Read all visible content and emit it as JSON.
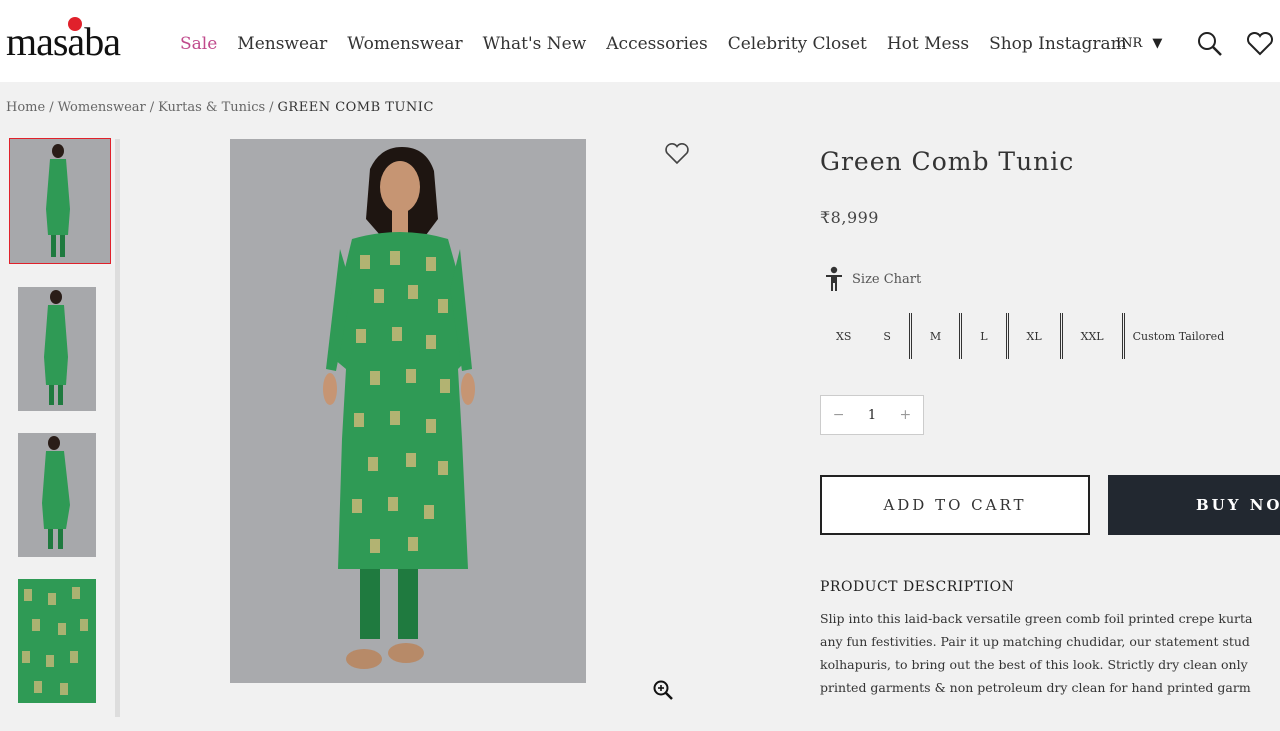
{
  "header": {
    "logo": "masaba",
    "nav": [
      "Sale",
      "Menswear",
      "Womenswear",
      "What's New",
      "Accessories",
      "Celebrity Closet",
      "Hot Mess",
      "Shop Instagram"
    ],
    "currency": "INR"
  },
  "breadcrumb": [
    "Home",
    "Womenswear",
    "Kurtas & Tunics",
    "GREEN COMB TUNIC"
  ],
  "product": {
    "title": "Green Comb Tunic",
    "price": "₹8,999",
    "size_chart_label": "Size Chart",
    "sizes": [
      "XS",
      "S",
      "M",
      "L",
      "XL",
      "XXL",
      "Custom Tailored"
    ],
    "quantity": "1",
    "add_to_cart": "ADD TO CART",
    "buy_now": "BUY NOW",
    "description_heading": "PRODUCT DESCRIPTION",
    "description_lines": [
      "Slip into this laid-back versatile green comb foil printed crepe kurta",
      "any fun festivities. Pair it up matching chudidar, our statement stud",
      "kolhapuris, to bring out the best of this look. Strictly dry clean only",
      "printed garments & non petroleum dry clean for hand printed garm"
    ]
  },
  "colors": {
    "accent_red": "#e0212b",
    "sale_pink": "#c04a8c",
    "kurta_green": "#2f9a55",
    "buy_button": "#222830"
  }
}
